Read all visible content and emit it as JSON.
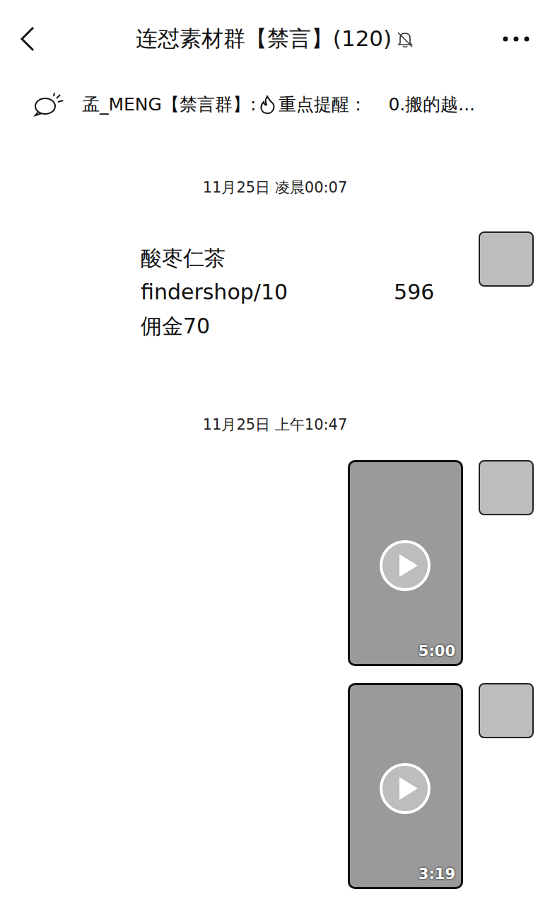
{
  "header": {
    "back": "<",
    "title": "连怼素材群【禁言】(120)",
    "muted": true
  },
  "pinned": {
    "sender": "孟_MENG【禁言群】:",
    "label": "重点提醒：",
    "preview": "0.搬的越..."
  },
  "messages": [
    {
      "kind": "time",
      "text": "11月25日 凌晨00:07"
    },
    {
      "kind": "text",
      "lines": [
        [
          "酸枣仁茶"
        ],
        [
          "findershop/10",
          "596"
        ],
        [
          "佣金70"
        ]
      ]
    },
    {
      "kind": "time",
      "text": "11月25日 上午10:47"
    },
    {
      "kind": "video",
      "duration": "5:00"
    },
    {
      "kind": "video",
      "duration": "3:19"
    }
  ]
}
